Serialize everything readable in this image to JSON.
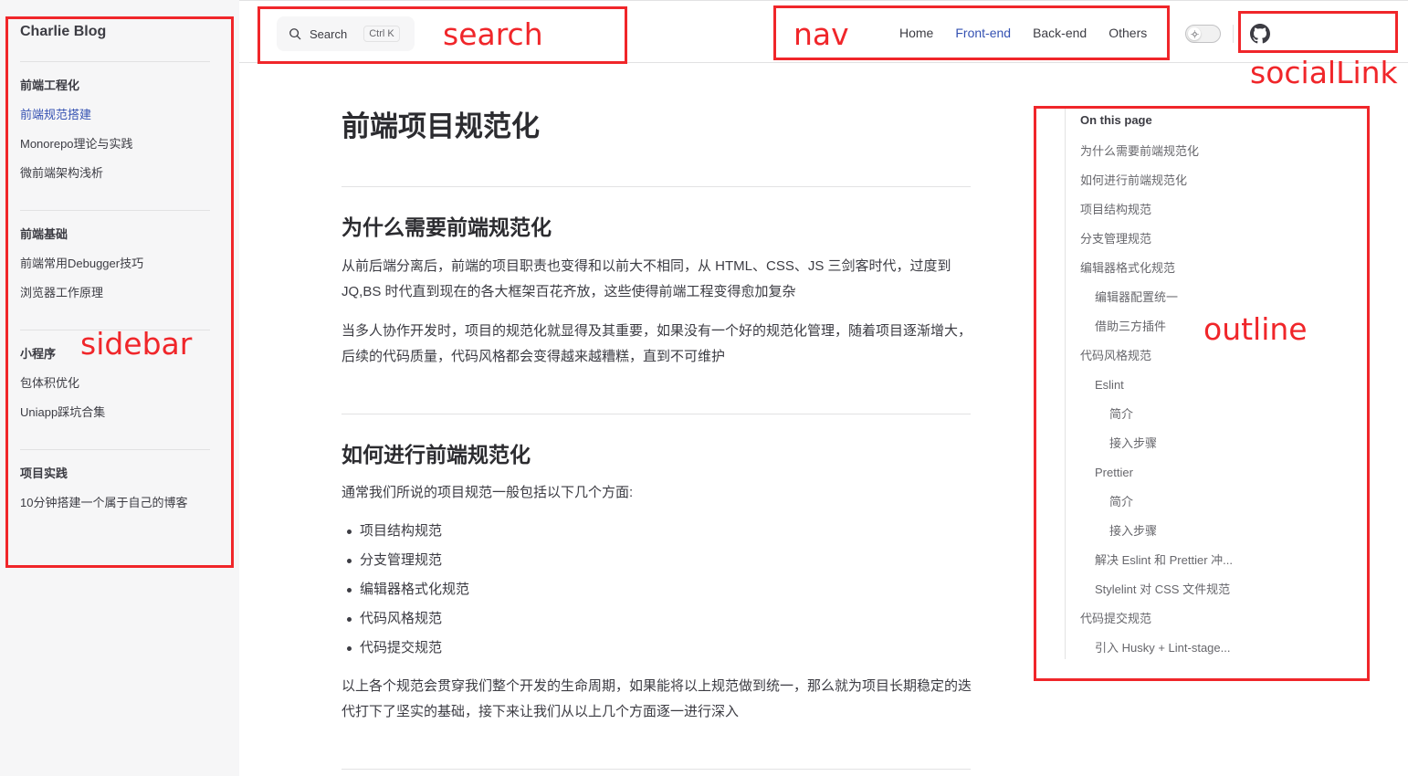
{
  "site_title": "Charlie Blog",
  "search": {
    "label": "Search",
    "shortcut": "Ctrl K"
  },
  "nav": [
    "Home",
    "Front-end",
    "Back-end",
    "Others"
  ],
  "nav_active": "Front-end",
  "sidebar": {
    "groups": [
      {
        "title": "前端工程化",
        "items": [
          "前端规范搭建",
          "Monorepo理论与实践",
          "微前端架构浅析"
        ]
      },
      {
        "title": "前端基础",
        "items": [
          "前端常用Debugger技巧",
          "浏览器工作原理"
        ]
      },
      {
        "title": "小程序",
        "items": [
          "包体积优化",
          "Uniapp踩坑合集"
        ]
      },
      {
        "title": "项目实践",
        "items": [
          "10分钟搭建一个属于自己的博客"
        ]
      }
    ],
    "active_item": "前端规范搭建"
  },
  "content": {
    "h1": "前端项目规范化",
    "sections": [
      {
        "h2": "为什么需要前端规范化",
        "paragraphs": [
          "从前后端分离后，前端的项目职责也变得和以前大不相同，从 HTML、CSS、JS 三剑客时代，过度到 JQ,BS 时代直到现在的各大框架百花齐放，这些使得前端工程变得愈加复杂",
          "当多人协作开发时，项目的规范化就显得及其重要，如果没有一个好的规范化管理，随着项目逐渐增大，后续的代码质量，代码风格都会变得越来越糟糕，直到不可维护"
        ]
      },
      {
        "h2": "如何进行前端规范化",
        "intro": "通常我们所说的项目规范一般包括以下几个方面:",
        "list": [
          "项目结构规范",
          "分支管理规范",
          "编辑器格式化规范",
          "代码风格规范",
          "代码提交规范"
        ],
        "outro": "以上各个规范会贯穿我们整个开发的生命周期，如果能将以上规范做到统一，那么就为项目长期稳定的迭代打下了坚实的基础，接下来让我们从以上几个方面逐一进行深入"
      }
    ]
  },
  "outline": {
    "title": "On this page",
    "items": [
      {
        "text": "为什么需要前端规范化",
        "level": 2
      },
      {
        "text": "如何进行前端规范化",
        "level": 2
      },
      {
        "text": "项目结构规范",
        "level": 2
      },
      {
        "text": "分支管理规范",
        "level": 2
      },
      {
        "text": "编辑器格式化规范",
        "level": 2
      },
      {
        "text": "编辑器配置统一",
        "level": 3
      },
      {
        "text": "借助三方插件",
        "level": 3
      },
      {
        "text": "代码风格规范",
        "level": 2
      },
      {
        "text": "Eslint",
        "level": 3
      },
      {
        "text": "简介",
        "level": 4
      },
      {
        "text": "接入步骤",
        "level": 4
      },
      {
        "text": "Prettier",
        "level": 3
      },
      {
        "text": "简介",
        "level": 4
      },
      {
        "text": "接入步骤",
        "level": 4
      },
      {
        "text": "解决 Eslint 和 Prettier 冲...",
        "level": 3
      },
      {
        "text": "Stylelint 对 CSS 文件规范",
        "level": 3
      },
      {
        "text": "代码提交规范",
        "level": 2
      },
      {
        "text": "引入 Husky + Lint-stage...",
        "level": 3
      }
    ]
  },
  "annotations": {
    "search": "search",
    "nav": "nav",
    "socialLink": "socialLink",
    "sidebar": "sidebar",
    "outline": "outline"
  },
  "colors": {
    "accent": "#3451b2",
    "annotation": "#f0262a",
    "sidebar_bg": "#f6f6f7",
    "text": "#3c3c43"
  },
  "icons": {
    "search": "search-icon",
    "theme": "sun-icon",
    "social": "github-icon"
  }
}
